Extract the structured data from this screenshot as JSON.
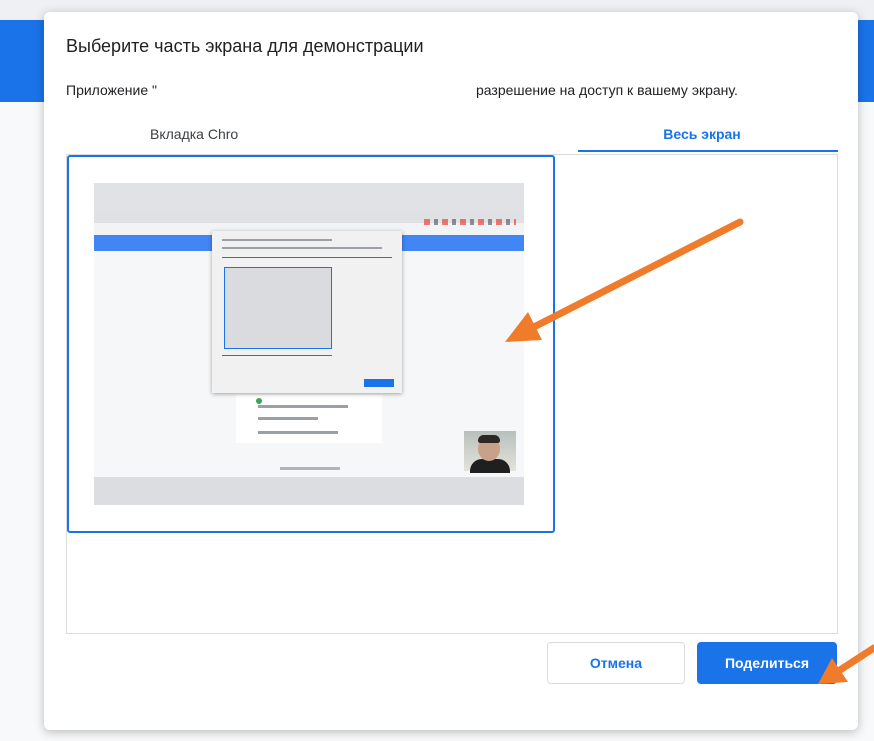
{
  "dialog": {
    "title": "Выберите часть экрана для демонстрации",
    "description_left": "Приложение \"",
    "description_right": "разрешение на доступ к вашему экрану."
  },
  "tabs": [
    {
      "label": "Вкладка Chro",
      "selected": false
    },
    {
      "label": "Весь экран",
      "selected": true
    }
  ],
  "buttons": {
    "cancel": "Отмена",
    "share": "Поделиться"
  },
  "colors": {
    "accent": "#1a73e8",
    "annotation_arrow": "#f07b2a"
  },
  "icons": {
    "annotation": "arrow-icon"
  }
}
